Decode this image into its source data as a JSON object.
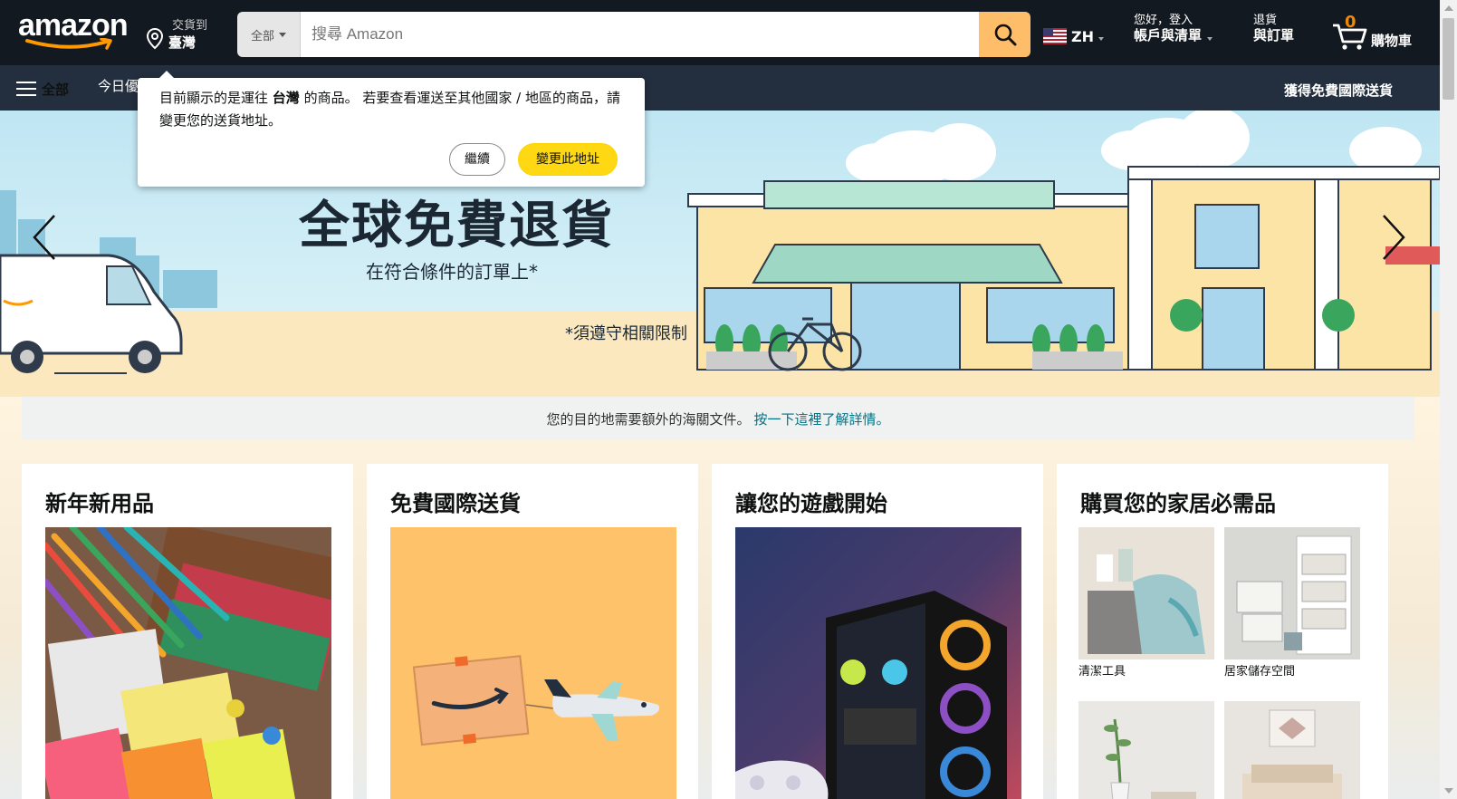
{
  "header": {
    "logo_text": "amazon",
    "deliver_to": {
      "line1": "交貨到",
      "line2": "臺灣"
    },
    "search": {
      "category": "全部",
      "placeholder": "搜尋 Amazon"
    },
    "language": "ZH",
    "account": {
      "line1": "您好，登入",
      "line2": "帳戶與清單"
    },
    "orders": {
      "line1": "退貨",
      "line2": "與訂單"
    },
    "cart": {
      "count": "0",
      "label": "購物車"
    }
  },
  "subnav": {
    "all_label": "全部",
    "today_deals": "今日優惠",
    "free_shipping": "獲得免費國際送貨"
  },
  "location_popover": {
    "text_before": "目前顯示的是運往",
    "country": "台灣",
    "text_after": "的商品。 若要查看運送至其他國家 / 地區的商品，請變更您的送貨地址。",
    "continue_label": "繼續",
    "change_label": "變更此地址"
  },
  "hero": {
    "title": "全球免費退貨",
    "subtitle": "在符合條件的訂單上*",
    "note": "*須遵守相關限制"
  },
  "customs": {
    "text": "您的目的地需要額外的海關文件。",
    "link": "按一下這裡了解詳情。"
  },
  "cards": [
    {
      "title": "新年新用品"
    },
    {
      "title": "免費國際送貨"
    },
    {
      "title": "讓您的遊戲開始"
    },
    {
      "title": "購買您的家居必需品",
      "tiles": [
        {
          "caption": "清潔工具"
        },
        {
          "caption": "居家儲存空間"
        },
        {
          "caption": ""
        },
        {
          "caption": ""
        }
      ]
    }
  ],
  "colors": {
    "nav_dark": "#131921",
    "nav_sub": "#232f3e",
    "search_button": "#febd69",
    "cart_count": "#f08804",
    "primary_button": "#ffd814",
    "link": "#007185"
  }
}
